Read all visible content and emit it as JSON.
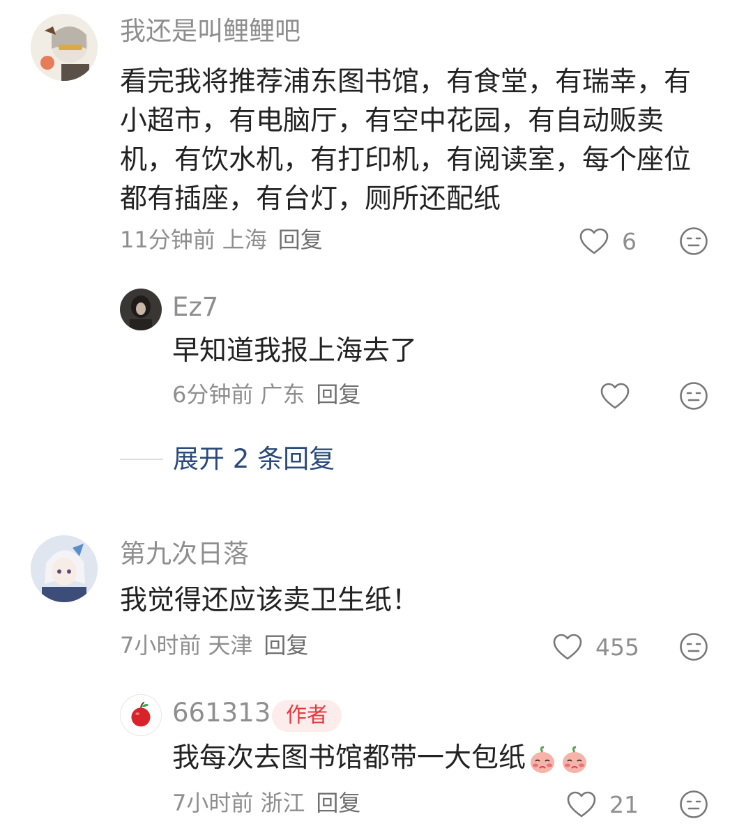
{
  "comments": [
    {
      "username": "我还是叫鲤鲤吧",
      "content": "看完我将推荐浦东图书馆，有食堂，有瑞幸，有小超市，有电脑厅，有空中花园，有自动贩卖机，有饮水机，有打印机，有阅读室，每个座位都有插座，有台灯，厕所还配纸",
      "time": "11分钟前",
      "location": "上海",
      "reply_label": "回复",
      "likes": "6",
      "replies": [
        {
          "username": "Ez7",
          "content": "早知道我报上海去了",
          "time": "6分钟前",
          "location": "广东",
          "reply_label": "回复",
          "likes": ""
        }
      ],
      "expand_label": "展开 2 条回复"
    },
    {
      "username": "第九次日落",
      "content": "我觉得还应该卖卫生纸！",
      "time": "7小时前",
      "location": "天津",
      "reply_label": "回复",
      "likes": "455",
      "replies": [
        {
          "username": "661313",
          "badge": "作者",
          "content": "我每次去图书馆都带一大包纸",
          "time": "7小时前",
          "location": "浙江",
          "reply_label": "回复",
          "likes": "21",
          "emoji": "blushing-peach-emoji"
        }
      ]
    }
  ],
  "icons": {
    "like": "heart-outline-icon",
    "dislike": "meh-face-icon"
  }
}
